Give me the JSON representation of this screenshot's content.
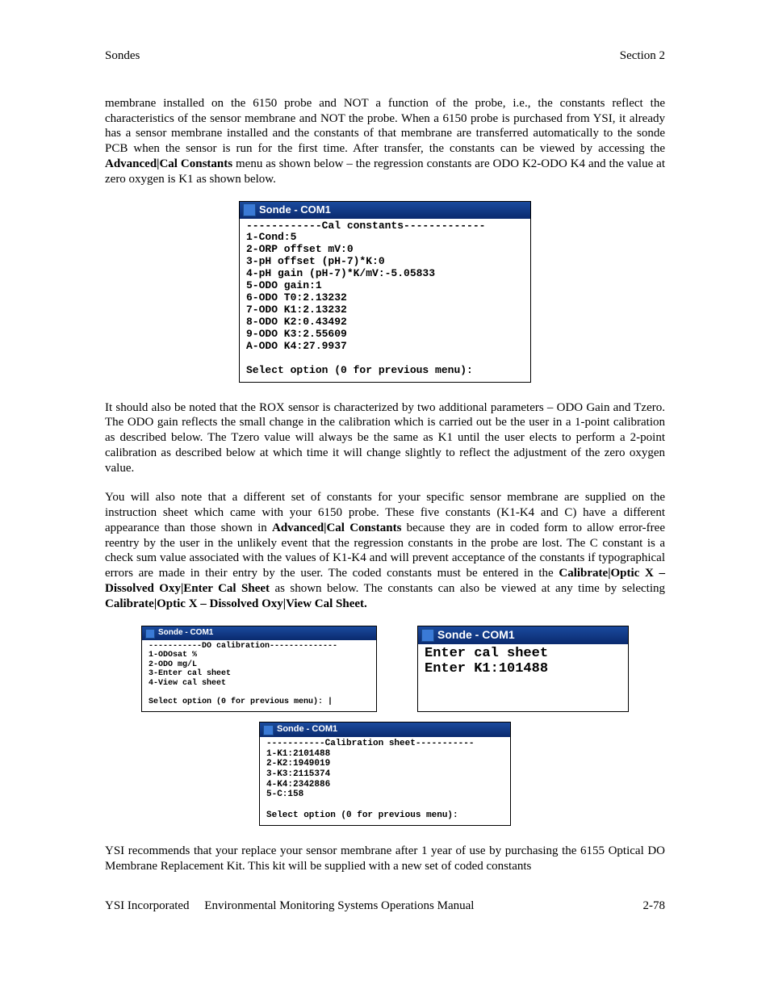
{
  "header": {
    "left": "Sondes",
    "right": "Section 2"
  },
  "para1_a": "membrane installed on the 6150 probe and NOT a function of the probe, i.e., the constants reflect the characteristics of the sensor membrane and NOT the probe.   When a 6150 probe is purchased from YSI, it already has a sensor membrane installed and the constants of that membrane are transferred automatically to the sonde PCB when the sensor is run for the first time.   After transfer, the constants can be viewed by accessing the ",
  "para1_b": "Advanced|Cal Constants",
  "para1_c": " menu as shown below – the regression constants are ODO K2-ODO K4 and the value at zero oxygen is K1 as shown below.",
  "term1": {
    "title": "Sonde - COM1",
    "body": "------------Cal constants-------------\n1-Cond:5\n2-ORP offset mV:0\n3-pH offset (pH-7)*K:0\n4-pH gain (pH-7)*K/mV:-5.05833\n5-ODO gain:1\n6-ODO T0:2.13232\n7-ODO K1:2.13232\n8-ODO K2:0.43492\n9-ODO K3:2.55609\nA-ODO K4:27.9937\n\nSelect option (0 for previous menu):"
  },
  "para2": "It should also be noted that the ROX sensor is characterized by two additional parameters – ODO Gain and Tzero.   The ODO gain reflects the small change in the calibration which is carried out be the user in a 1-point calibration as described below.   The Tzero value will always be the same as K1 until the user elects to perform a 2-point calibration as described below at which time it will change slightly to reflect the adjustment of the zero oxygen value.",
  "para3_a": "You will also note that a different set of constants for your specific sensor membrane are supplied on the instruction sheet which came with your 6150 probe.   These five constants (K1-K4 and C) have a different appearance than those shown in ",
  "para3_b": "Advanced|Cal Constants",
  "para3_c": " because they are in coded form to allow error-free reentry by the user in the unlikely event that the regression constants in the probe are lost.   The C constant is a check sum value associated with the values of K1-K4 and will prevent acceptance of the constants if typographical errors are made in their entry by the user.   The coded constants must be entered in the ",
  "para3_d": "Calibrate|Optic X – Dissolved Oxy|Enter Cal Sheet",
  "para3_e": " as shown below.   The constants can also be viewed at any time by selecting ",
  "para3_f": "Calibrate|Optic X – Dissolved Oxy|View Cal Sheet.",
  "term2": {
    "title": "Sonde - COM1",
    "body": "-----------DO calibration--------------\n1-ODOsat %\n2-ODO mg/L\n3-Enter cal sheet\n4-View cal sheet\n\nSelect option (0 for previous menu): |"
  },
  "term3": {
    "title": "Sonde - COM1",
    "body": "Enter cal sheet\nEnter K1:101488\n\n"
  },
  "term4": {
    "title": "Sonde - COM1",
    "body": "-----------Calibration sheet-----------\n1-K1:2101488\n2-K2:1949019\n3-K3:2115374\n4-K4:2342886\n5-C:158\n\nSelect option (0 for previous menu):"
  },
  "para4": "YSI recommends that your replace your sensor membrane after 1 year of use by purchasing the 6155 Optical DO Membrane Replacement Kit.   This kit will be supplied with a new set of coded constants",
  "footer": {
    "left": "YSI Incorporated",
    "center": "Environmental Monitoring Systems Operations Manual",
    "right": "2-78"
  }
}
